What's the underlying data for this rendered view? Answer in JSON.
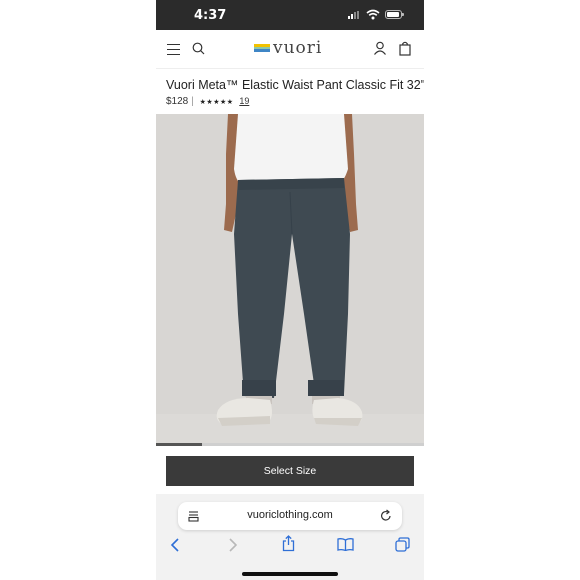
{
  "status_bar": {
    "time": "4:37"
  },
  "header": {
    "logo_text": "vuori",
    "logo_colors": [
      "#f2c200",
      "#8fc7a8",
      "#3f86c6"
    ]
  },
  "product": {
    "title": "Vuori Meta™ Elastic Waist Pant Classic Fit 32\"",
    "price": "$128",
    "separator": "|",
    "stars": "★★★★★",
    "rating_value": 5,
    "review_count": "19",
    "image_progress": 0.17
  },
  "actions": {
    "select_size_label": "Select Size"
  },
  "browser": {
    "url": "vuoriclothing.com"
  },
  "colors": {
    "button_bg": "#3a3a3a",
    "pant": "#3f4a52",
    "tshirt": "#f4f4f4",
    "backdrop": "#d8d6d3"
  }
}
